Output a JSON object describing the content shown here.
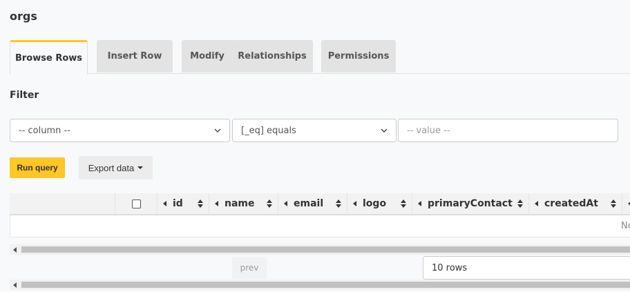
{
  "page": {
    "title": "orgs"
  },
  "tabs": [
    {
      "label": "Browse Rows",
      "active": true
    },
    {
      "label": "Insert Row"
    },
    {
      "label": "Modify"
    },
    {
      "label": "Relationships"
    },
    {
      "label": "Permissions"
    }
  ],
  "filter": {
    "label": "Filter",
    "column_select": "-- column --",
    "operator_select": "[_eq] equals",
    "value_placeholder": "-- value --"
  },
  "actions": {
    "run_query": "Run query",
    "export_data": "Export data"
  },
  "table": {
    "columns": [
      "id",
      "name",
      "email",
      "logo",
      "primaryContact",
      "createdAt"
    ],
    "empty_text": "No"
  },
  "pagination": {
    "prev": "prev",
    "rows_per_page": "10 rows"
  },
  "colors": {
    "accent": "#ffc627",
    "tab_inactive": "#e3e3e3",
    "background": "#f8f9fa"
  }
}
